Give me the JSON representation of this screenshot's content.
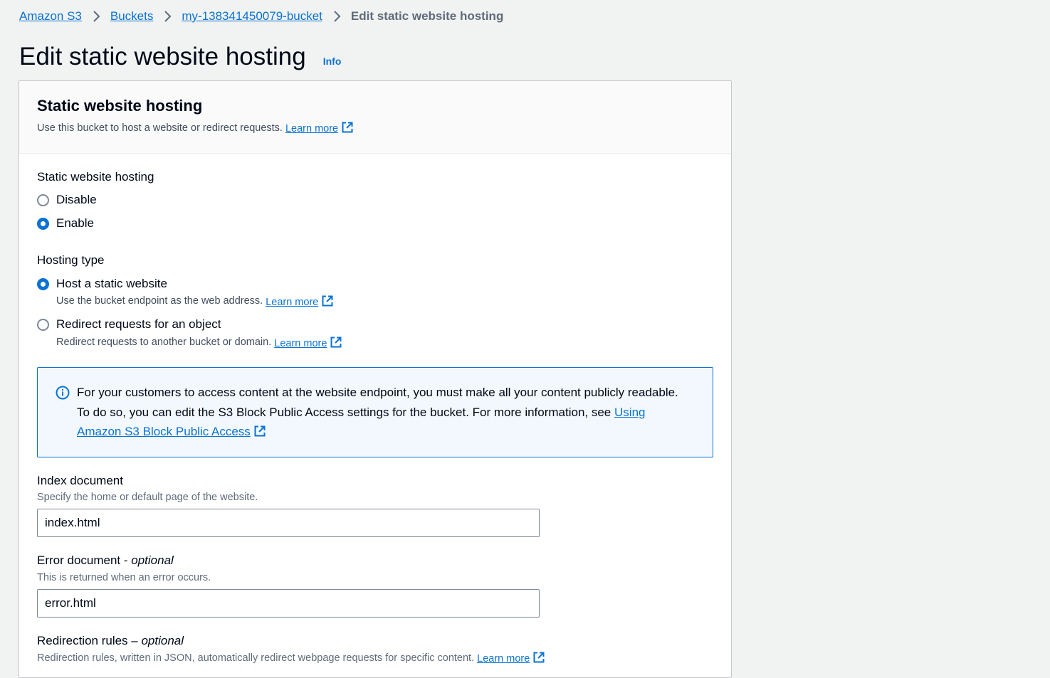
{
  "breadcrumb": {
    "items": [
      "Amazon S3",
      "Buckets",
      "my-138341450079-bucket"
    ],
    "current": "Edit static website hosting"
  },
  "page": {
    "title": "Edit static website hosting",
    "info": "Info"
  },
  "panel": {
    "title": "Static website hosting",
    "description": "Use this bucket to host a website or redirect requests.",
    "learn_more": "Learn more"
  },
  "hosting": {
    "label": "Static website hosting",
    "options": [
      "Disable",
      "Enable"
    ],
    "selected": "Enable"
  },
  "hosting_type": {
    "label": "Hosting type",
    "options": [
      {
        "label": "Host a static website",
        "description": "Use the bucket endpoint as the web address.",
        "learn_more": "Learn more"
      },
      {
        "label": "Redirect requests for an object",
        "description": "Redirect requests to another bucket or domain.",
        "learn_more": "Learn more"
      }
    ],
    "selected": "Host a static website"
  },
  "alert": {
    "text": "For your customers to access content at the website endpoint, you must make all your content publicly readable. To do so, you can edit the S3 Block Public Access settings for the bucket. For more information, see",
    "link": "Using Amazon S3 Block Public Access"
  },
  "index_document": {
    "label": "Index document",
    "hint": "Specify the home or default page of the website.",
    "value": "index.html"
  },
  "error_document": {
    "label": "Error document - ",
    "optional": "optional",
    "hint": "This is returned when an error occurs.",
    "value": "error.html"
  },
  "redirection_rules": {
    "label": "Redirection rules – ",
    "optional": "optional",
    "hint": "Redirection rules, written in JSON, automatically redirect webpage requests for specific content.",
    "learn_more": "Learn more"
  },
  "colors": {
    "link": "#0972d3",
    "alert_bg": "#f2f8fd",
    "page_bg": "#f1f2f2"
  }
}
